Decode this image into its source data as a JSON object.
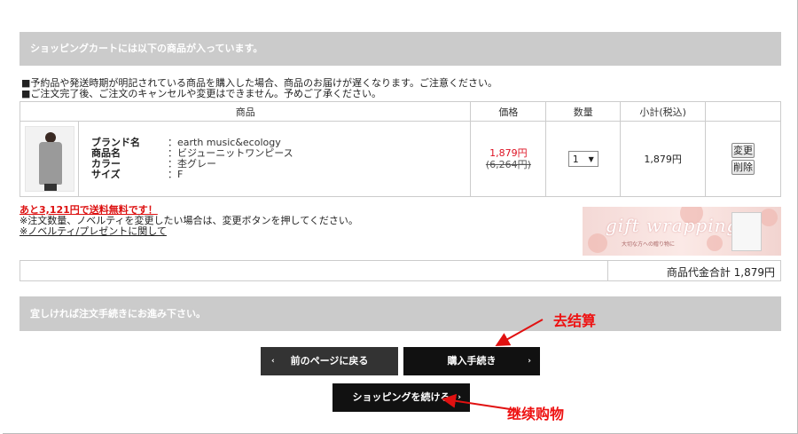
{
  "header_bar": "ショッピングカートには以下の商品が入っています。",
  "notes": [
    "■予約品や発送時期が明記されている商品を購入した場合、商品のお届けが遅くなります。ご注意ください。",
    "■ご注文完了後、ご注文のキャンセルや変更はできません。予めご了承ください。"
  ],
  "table": {
    "headers": [
      "商品",
      "価格",
      "数量",
      "小計(税込)",
      ""
    ],
    "item": {
      "attrs": [
        {
          "key": "ブランド名",
          "value": "：earth music&ecology"
        },
        {
          "key": "商品名",
          "value": "：ビジューニットワンピース"
        },
        {
          "key": "カラー",
          "value": "：杢グレー"
        },
        {
          "key": "サイズ",
          "value": "：F"
        }
      ],
      "sale_price": "1,879円",
      "original_price": "(6,264円)",
      "quantity": "1",
      "subtotal": "1,879円",
      "change_label": "変更",
      "delete_label": "削除"
    }
  },
  "shipping": {
    "free_notice": "あと3,121円で送料無料です！",
    "change_note": "※注文数量、ノベルティを変更したい場合は、変更ボタンを押してください。",
    "novelty_link": "※ノベルティ/プレゼントに関して"
  },
  "gift_banner": {
    "title": "gift wrapping",
    "subtitle": "大切な方への贈り物に"
  },
  "total": "商品代金合計 1,879円",
  "proceed_bar": "宜しければ注文手続きにお進み下さい。",
  "buttons": {
    "back": "前のページに戻る",
    "purchase": "購入手続き",
    "continue": "ショッピングを続ける"
  },
  "annotations": {
    "checkout": "去结算",
    "continue": "继续购物"
  },
  "colors": {
    "annotation": "#e11111",
    "sale": "#d11122"
  }
}
